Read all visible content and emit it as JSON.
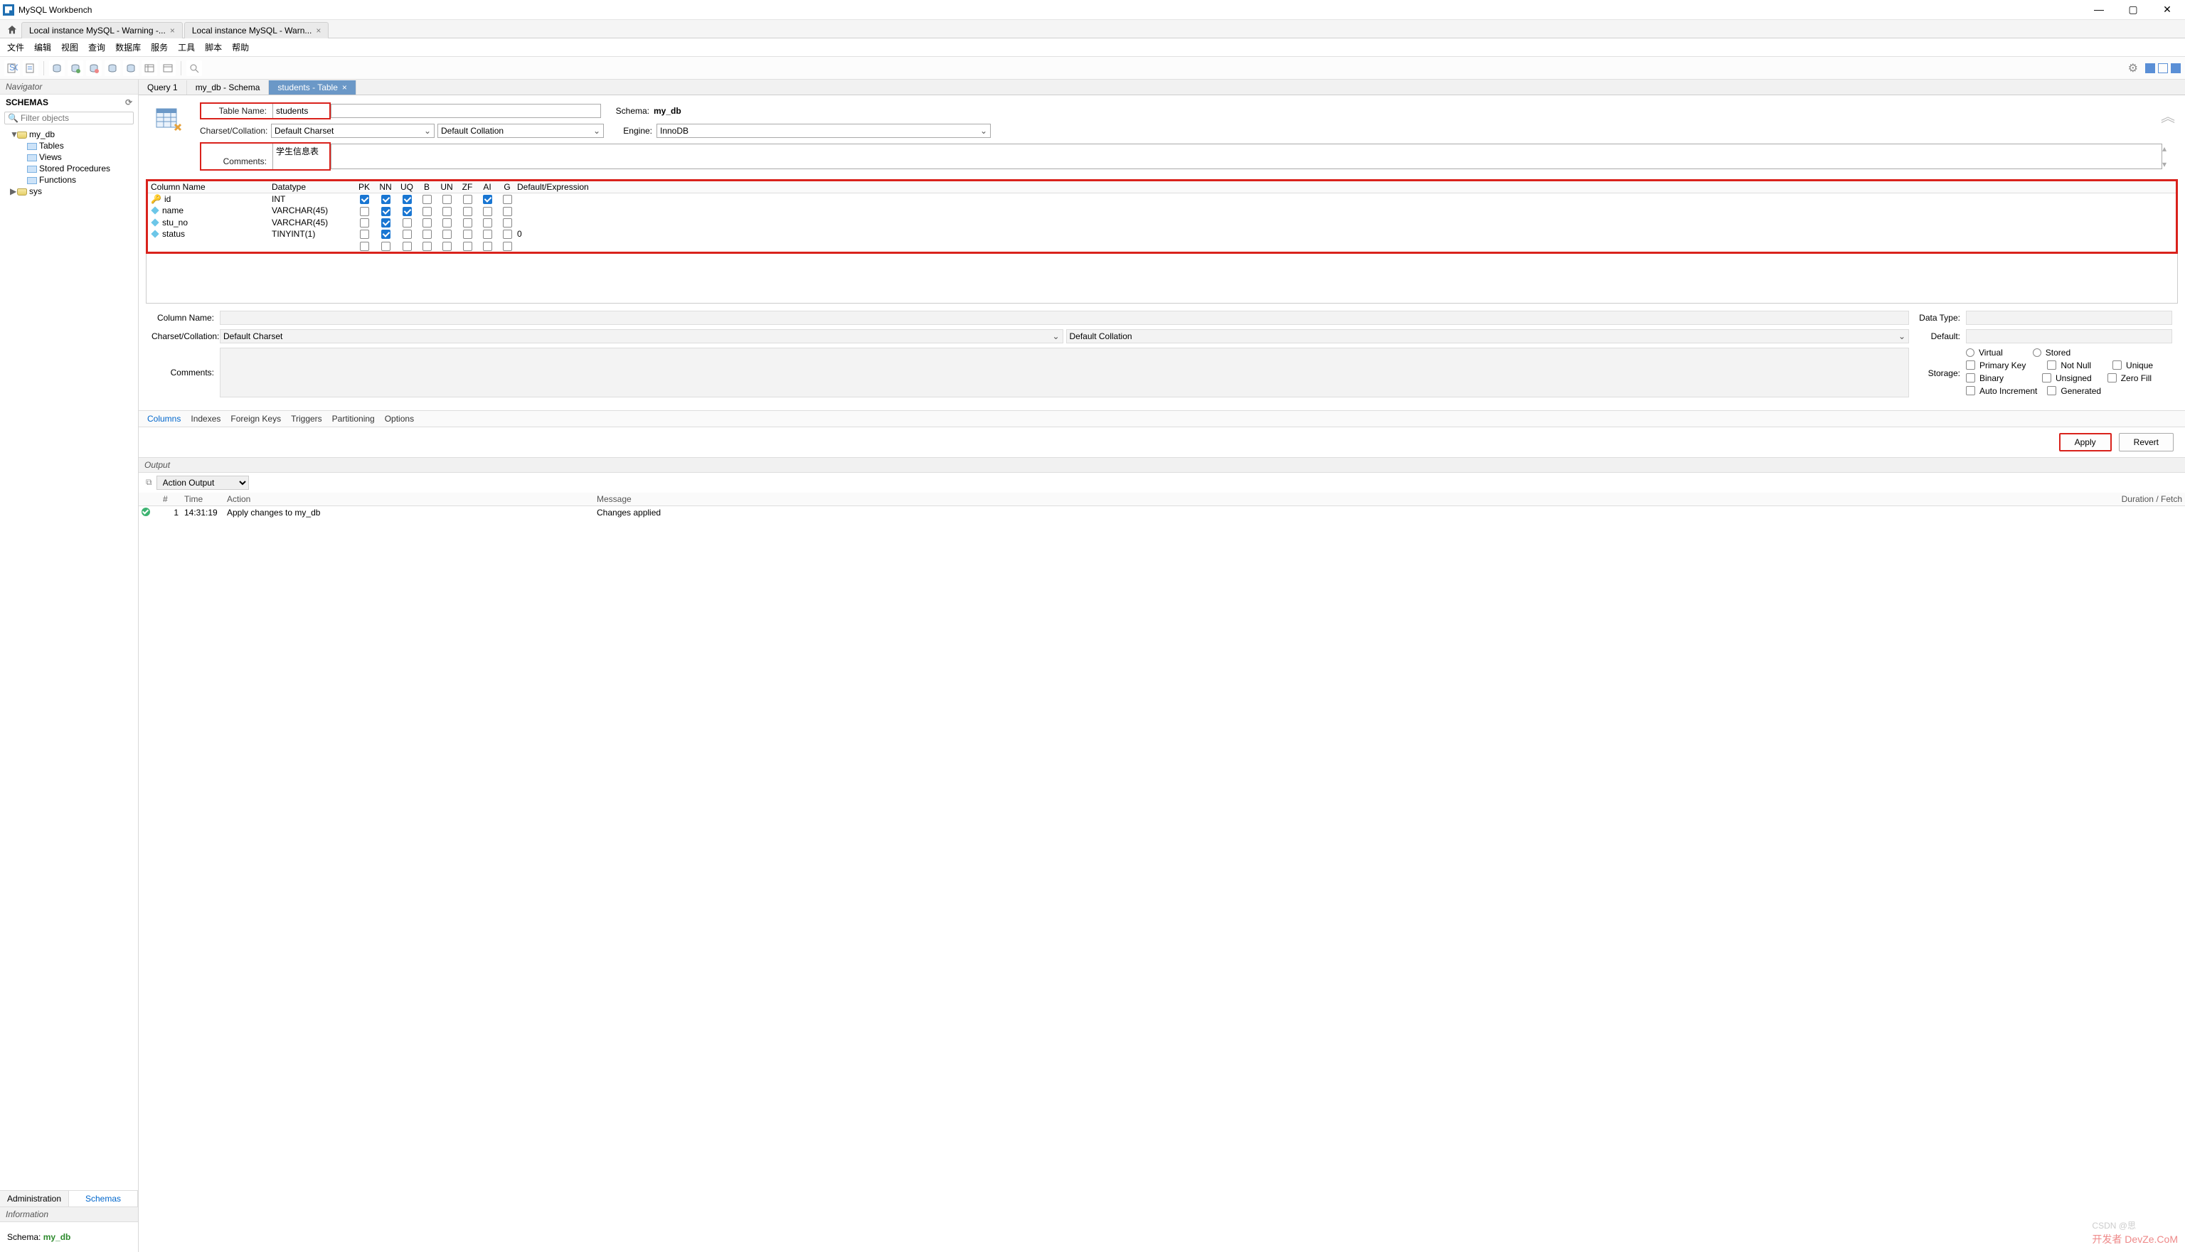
{
  "app": {
    "title": "MySQL Workbench"
  },
  "conn_tabs": [
    {
      "label": "Local instance MySQL - Warning -..."
    },
    {
      "label": "Local instance MySQL - Warn..."
    }
  ],
  "menu": [
    "文件",
    "编辑",
    "视图",
    "查询",
    "数据库",
    "服务",
    "工具",
    "脚本",
    "帮助"
  ],
  "navigator": {
    "header": "Navigator",
    "schemas_label": "SCHEMAS",
    "filter_placeholder": "Filter objects",
    "tree": {
      "db1": "my_db",
      "db1_children": [
        "Tables",
        "Views",
        "Stored Procedures",
        "Functions"
      ],
      "db2": "sys"
    },
    "tabs": {
      "admin": "Administration",
      "schemas": "Schemas"
    },
    "info_header": "Information",
    "info_label": "Schema:",
    "info_value": "my_db"
  },
  "doc_tabs": [
    {
      "label": "Query 1",
      "active": false
    },
    {
      "label": "my_db - Schema",
      "active": false
    },
    {
      "label": "students - Table",
      "active": true
    }
  ],
  "table_form": {
    "name_label": "Table Name:",
    "name_value": "students",
    "charset_label": "Charset/Collation:",
    "charset_value": "Default Charset",
    "collation_value": "Default Collation",
    "schema_label": "Schema:",
    "schema_value": "my_db",
    "engine_label": "Engine:",
    "engine_value": "InnoDB",
    "comments_label": "Comments:",
    "comments_value": "学生信息表"
  },
  "columns_grid": {
    "headers": [
      "Column Name",
      "Datatype",
      "PK",
      "NN",
      "UQ",
      "B",
      "UN",
      "ZF",
      "AI",
      "G",
      "Default/Expression"
    ],
    "rows": [
      {
        "icon": "key",
        "name": "id",
        "datatype": "INT",
        "pk": true,
        "nn": true,
        "uq": true,
        "b": false,
        "un": false,
        "zf": false,
        "ai": true,
        "g": false,
        "def": ""
      },
      {
        "icon": "dia",
        "name": "name",
        "datatype": "VARCHAR(45)",
        "pk": false,
        "nn": true,
        "uq": true,
        "b": false,
        "un": false,
        "zf": false,
        "ai": false,
        "g": false,
        "def": ""
      },
      {
        "icon": "dia",
        "name": "stu_no",
        "datatype": "VARCHAR(45)",
        "pk": false,
        "nn": true,
        "uq": false,
        "b": false,
        "un": false,
        "zf": false,
        "ai": false,
        "g": false,
        "def": ""
      },
      {
        "icon": "dia",
        "name": "status",
        "datatype": "TINYINT(1)",
        "pk": false,
        "nn": true,
        "uq": false,
        "b": false,
        "un": false,
        "zf": false,
        "ai": false,
        "g": false,
        "def": "0"
      },
      {
        "icon": "",
        "name": "",
        "datatype": "",
        "pk": false,
        "nn": false,
        "uq": false,
        "b": false,
        "un": false,
        "zf": false,
        "ai": false,
        "g": false,
        "def": ""
      }
    ]
  },
  "col_detail": {
    "name_label": "Column Name:",
    "datatype_label": "Data Type:",
    "charset_label": "Charset/Collation:",
    "charset_value": "Default Charset",
    "collation_value": "Default Collation",
    "default_label": "Default:",
    "comments_label": "Comments:",
    "storage_label": "Storage:",
    "opts": {
      "virtual": "Virtual",
      "stored": "Stored",
      "pk": "Primary Key",
      "nn": "Not Null",
      "uq": "Unique",
      "bin": "Binary",
      "un": "Unsigned",
      "zf": "Zero Fill",
      "ai": "Auto Increment",
      "gen": "Generated"
    }
  },
  "bottom_tabs": [
    "Columns",
    "Indexes",
    "Foreign Keys",
    "Triggers",
    "Partitioning",
    "Options"
  ],
  "bottom_tabs_active": "Columns",
  "buttons": {
    "apply": "Apply",
    "revert": "Revert"
  },
  "output": {
    "header": "Output",
    "mode": "Action Output",
    "cols": {
      "num": "#",
      "time": "Time",
      "action": "Action",
      "message": "Message",
      "duration": "Duration / Fetch"
    },
    "rows": [
      {
        "ok": true,
        "num": "1",
        "time": "14:31:19",
        "action": "Apply changes to my_db",
        "message": "Changes applied",
        "duration": ""
      }
    ]
  },
  "watermark": {
    "line1": "CSDN @思",
    "line2": "开发者 DevZe.CoM"
  }
}
